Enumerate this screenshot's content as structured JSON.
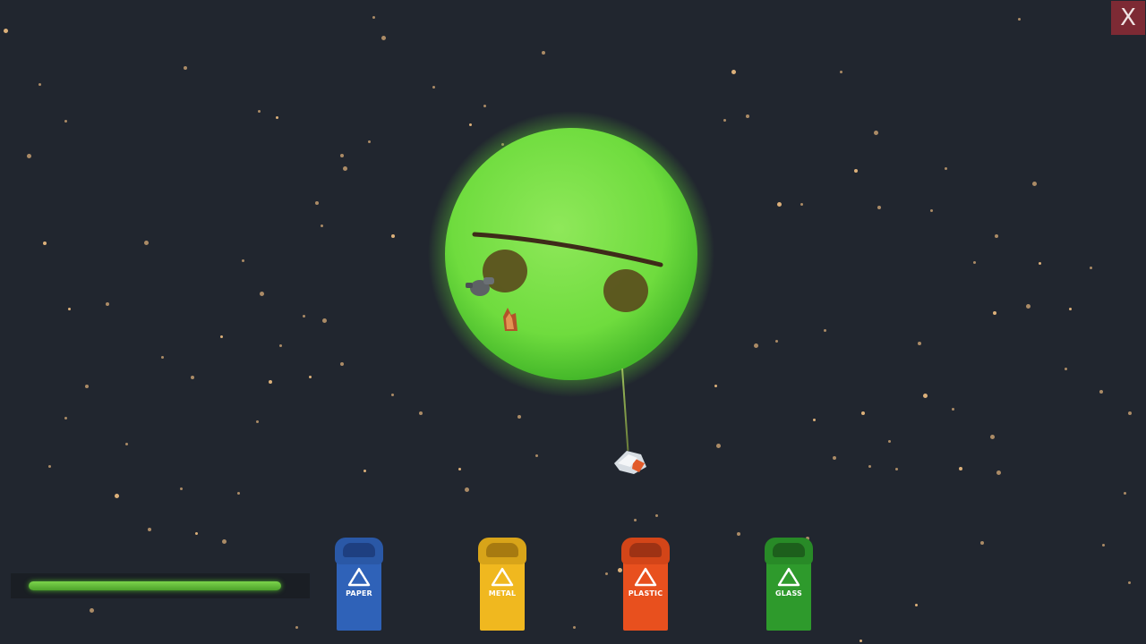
{
  "close_button": {
    "label": "X"
  },
  "planet": {
    "mood": "frowning",
    "color": "#7fe44a"
  },
  "health_bar": {
    "level": 0.94,
    "color": "#5dbb33"
  },
  "bins": [
    {
      "label": "PAPER",
      "color": "#2f62b8",
      "icon": "recycle-icon"
    },
    {
      "label": "METAL",
      "color": "#f0b81f",
      "icon": "recycle-icon"
    },
    {
      "label": "PLASTIC",
      "color": "#e8501e",
      "icon": "recycle-icon"
    },
    {
      "label": "GLASS",
      "color": "#2e9a2c",
      "icon": "recycle-icon"
    }
  ],
  "colors": {
    "background": "#21262f",
    "star": "#e7b77e",
    "close_bg": "#7d2a34"
  }
}
